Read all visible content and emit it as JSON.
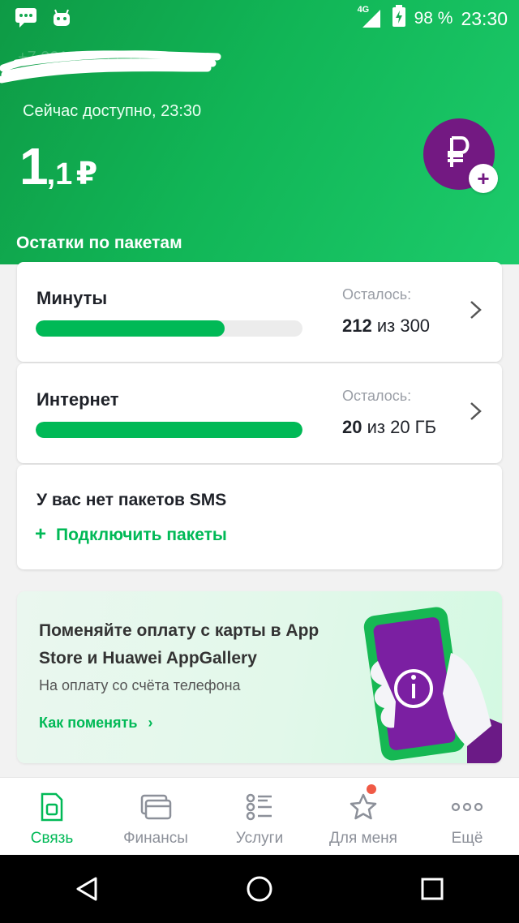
{
  "status_bar": {
    "network": "4G",
    "battery": "98 %",
    "time": "23:30",
    "left_icons": [
      "message-icon",
      "android-icon"
    ]
  },
  "header": {
    "phone_number": "+7 921 3?? ?? ??",
    "available_label": "Сейчас доступно, 23:30",
    "balance_int": "1",
    "balance_frac": ",1",
    "currency": "₽",
    "topup_icon": "ruble-plus-icon"
  },
  "packages": {
    "title": "Остатки по пакетам",
    "items": [
      {
        "name": "Минуты",
        "remain_label": "Осталось:",
        "remain_value": "212",
        "remain_rest": "из 300",
        "fraction": 0.7067
      },
      {
        "name": "Интернет",
        "remain_label": "Осталось:",
        "remain_value": "20",
        "remain_rest": "из 20 ГБ",
        "fraction": 1.0
      }
    ],
    "sms": {
      "title": "У вас нет пакетов SMS",
      "link_plus": "+",
      "link": "Подключить пакеты"
    }
  },
  "promo": {
    "title": "Поменяйте оплату с карты в App Store и Huawei AppGallery",
    "subtitle": "На оплату со счёта телефона",
    "link": "Как поменять",
    "link_chevron": "›"
  },
  "tabs": [
    {
      "label": "Связь",
      "icon": "sim-icon",
      "active": true
    },
    {
      "label": "Финансы",
      "icon": "card-icon",
      "active": false
    },
    {
      "label": "Услуги",
      "icon": "list-icon",
      "active": false
    },
    {
      "label": "Для меня",
      "icon": "star-icon",
      "active": false,
      "badge": true
    },
    {
      "label": "Ещё",
      "icon": "more-icon",
      "active": false
    }
  ],
  "colors": {
    "brand_green": "#00b956",
    "brand_purple": "#731982",
    "badge_red": "#f05a46"
  }
}
